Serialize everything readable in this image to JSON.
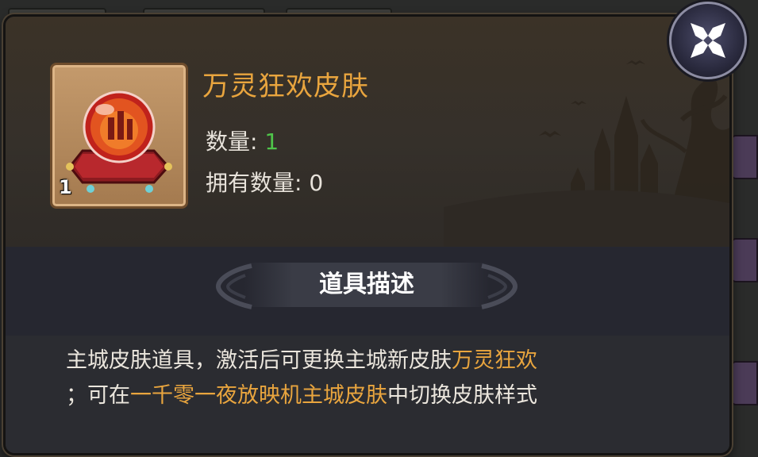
{
  "item": {
    "name": "万灵狂欢皮肤",
    "count_badge": "1",
    "icon": "crystal-ball-on-cushion-icon"
  },
  "stats": {
    "quantity_label": "数量:",
    "quantity_value": "1",
    "owned_label": "拥有数量:",
    "owned_value": "0"
  },
  "section": {
    "title": "道具描述"
  },
  "description": {
    "part1": "主城皮肤道具，激活后可更换主城新皮肤",
    "hl1": "万灵狂欢",
    "part2": "；可在",
    "hl2": "一千零一夜放映机主城皮肤",
    "part3": "中切换皮肤样式"
  },
  "close": {
    "icon": "close-x-icon"
  },
  "colors": {
    "highlight": "#e9a53e",
    "quantity_green": "#4fc44a",
    "text": "#ebe6dd"
  }
}
